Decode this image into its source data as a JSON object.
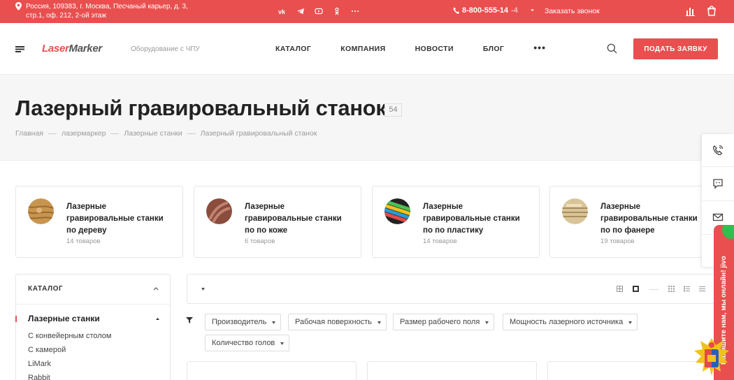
{
  "topbar": {
    "address": "Россия, 109383, г. Москва, Песчаный карьер, д. 3, стр.1, оф. 212, 2-ой этаж",
    "phone_main": "8-800-555-14",
    "phone_fade": "-4",
    "callback": "Заказать звонок",
    "social_icons": [
      "vk-icon",
      "telegram-icon",
      "youtube-icon",
      "odnoklassniki-icon",
      "more-icon"
    ]
  },
  "header": {
    "logo_part1": "Laser",
    "logo_part2": "Marker",
    "tagline": "Оборудование с ЧПУ",
    "nav": [
      "КАТАЛОГ",
      "КОМПАНИЯ",
      "НОВОСТИ",
      "БЛОГ"
    ],
    "nav_more": "•••",
    "cta": "ПОДАТЬ ЗАЯВКУ"
  },
  "page": {
    "title": "Лазерный гравировальный станок",
    "count": "54",
    "breadcrumbs": [
      "Главная",
      "лазермаркер",
      "Лазерные станки",
      "Лазерный гравировальный станок"
    ]
  },
  "categories": [
    {
      "title": "Лазерные гравировальные станки по дереву",
      "count": "14 товаров"
    },
    {
      "title": "Лазерные гравировальные станки по по коже",
      "count": "6 товаров"
    },
    {
      "title": "Лазерные гравировальные станки по по пластику",
      "count": "14 товаров"
    },
    {
      "title": "Лазерные гравировальные станки по по фанере",
      "count": "19 товаров"
    }
  ],
  "sidebar": {
    "heading": "КАТАЛОГ",
    "active": "Лазерные станки",
    "items": [
      "С конвейерным столом",
      "С камерой",
      "LiMark",
      "Rabbit"
    ]
  },
  "filters": [
    "Производитель",
    "Рабочая поверхность",
    "Размер рабочего поля",
    "Мощность лазерного источника",
    "Количество голов"
  ],
  "jivo": {
    "text": "Напишите нам, мы онлайн!",
    "brand": "jivo"
  },
  "colors": {
    "accent": "#e94f4f",
    "jivo_green": "#2fbf4f"
  }
}
